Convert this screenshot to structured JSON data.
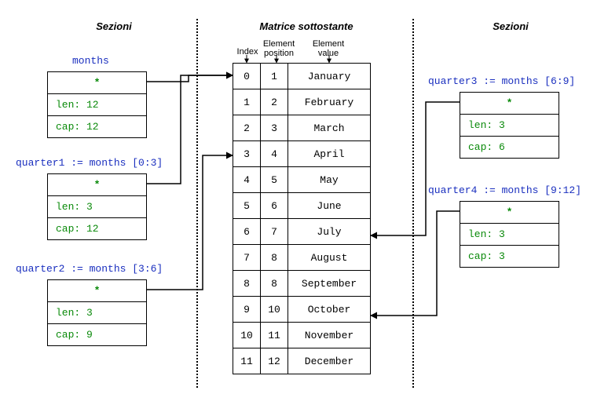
{
  "headers": {
    "left": "Sezioni",
    "center": "Matrice sottostante",
    "right": "Sezioni"
  },
  "columns": {
    "index": "Index",
    "position": "Element\nposition",
    "value": "Element\nvalue"
  },
  "matrix": [
    {
      "idx": "0",
      "pos": "1",
      "val": "January"
    },
    {
      "idx": "1",
      "pos": "2",
      "val": "February"
    },
    {
      "idx": "2",
      "pos": "3",
      "val": "March"
    },
    {
      "idx": "3",
      "pos": "4",
      "val": "April"
    },
    {
      "idx": "4",
      "pos": "5",
      "val": "May"
    },
    {
      "idx": "5",
      "pos": "6",
      "val": "June"
    },
    {
      "idx": "6",
      "pos": "7",
      "val": "July"
    },
    {
      "idx": "7",
      "pos": "8",
      "val": "August"
    },
    {
      "idx": "8",
      "pos": "8",
      "val": "September"
    },
    {
      "idx": "9",
      "pos": "10",
      "val": "October"
    },
    {
      "idx": "10",
      "pos": "11",
      "val": "November"
    },
    {
      "idx": "11",
      "pos": "12",
      "val": "December"
    }
  ],
  "slices": {
    "months": {
      "title": "months",
      "star": "*",
      "len": "len: 12",
      "cap": "cap: 12"
    },
    "quarter1": {
      "title": "quarter1 := months [0:3]",
      "star": "*",
      "len": "len: 3",
      "cap": "cap: 12"
    },
    "quarter2": {
      "title": "quarter2 := months [3:6]",
      "star": "*",
      "len": "len: 3",
      "cap": "cap: 9"
    },
    "quarter3": {
      "title": "quarter3 := months [6:9]",
      "star": "*",
      "len": "len: 3",
      "cap": "cap: 6"
    },
    "quarter4": {
      "title": "quarter4 := months [9:12]",
      "star": "*",
      "len": "len: 3",
      "cap": "cap: 3"
    }
  }
}
